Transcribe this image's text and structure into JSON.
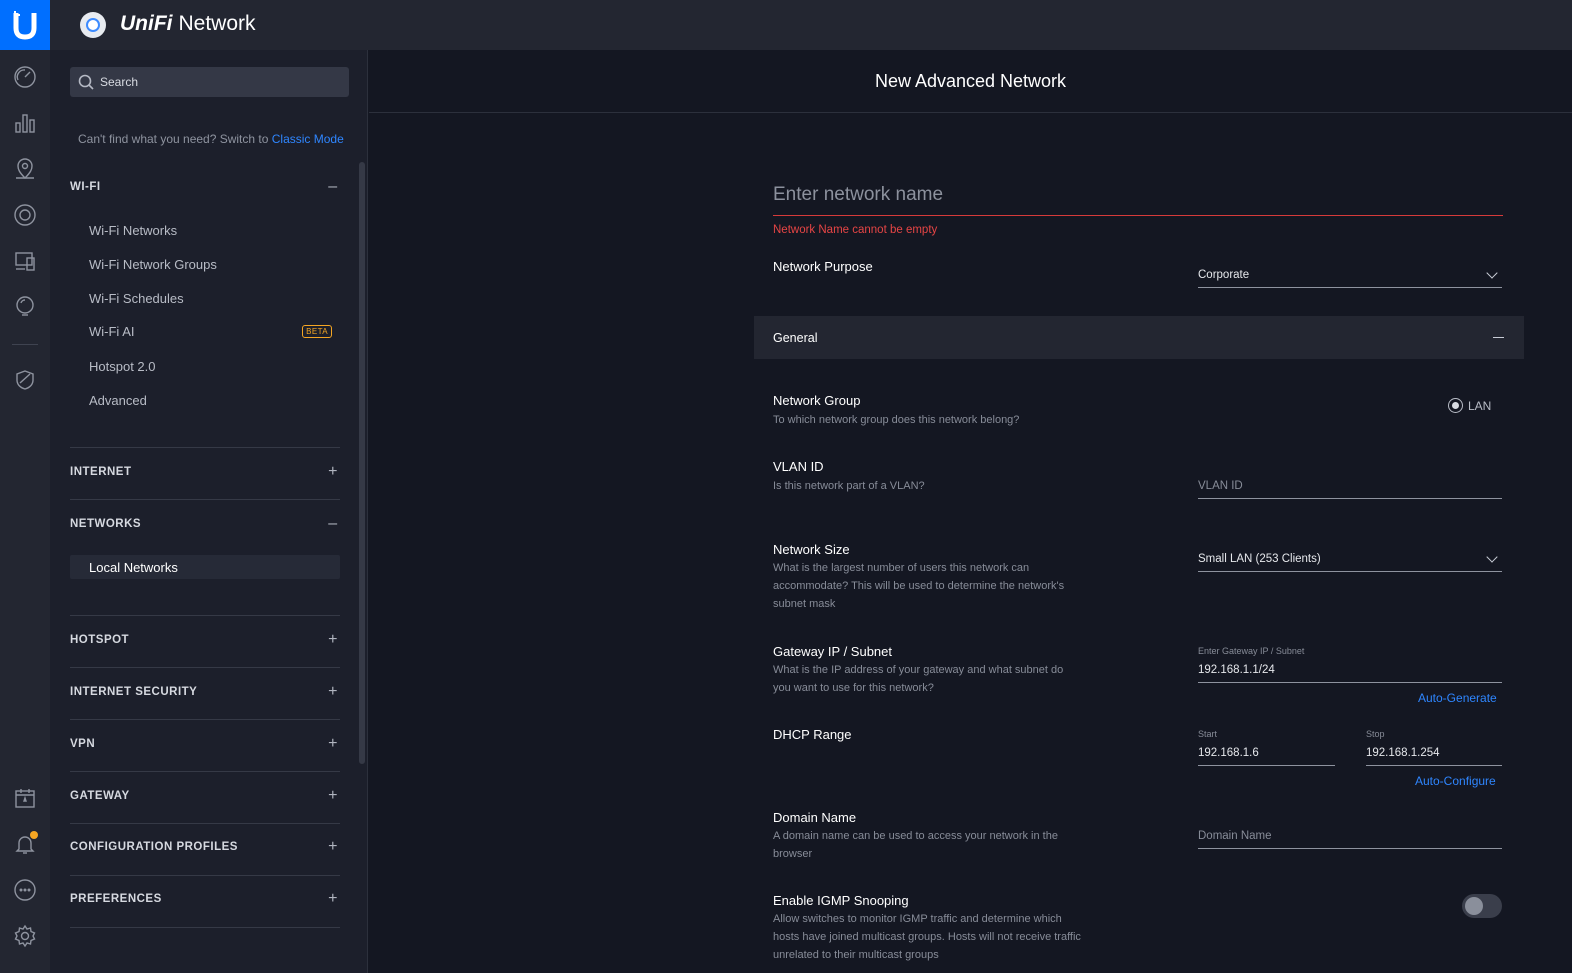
{
  "app": {
    "brand": "UniFi",
    "title": "Network"
  },
  "rail": {
    "items": [
      "dashboard-icon",
      "statistics-icon",
      "map-icon",
      "devices-icon",
      "clients-icon",
      "insights-icon",
      "security-shield-icon",
      "calendar-icon",
      "notifications-bell-icon",
      "chat-icon",
      "settings-gear-icon"
    ]
  },
  "sidebar": {
    "search": {
      "placeholder": "Search"
    },
    "classic_text": "Can't find what you need? Switch to",
    "classic_link": "Classic Mode",
    "sections": {
      "wifi": {
        "label": "WI-FI",
        "toggle": "–"
      },
      "internet": {
        "label": "INTERNET",
        "toggle": "+"
      },
      "networks": {
        "label": "NETWORKS",
        "toggle": "–"
      },
      "hotspot": {
        "label": "HOTSPOT",
        "toggle": "+"
      },
      "internet_security": {
        "label": "INTERNET SECURITY",
        "toggle": "+"
      },
      "vpn": {
        "label": "VPN",
        "toggle": "+"
      },
      "gateway": {
        "label": "GATEWAY",
        "toggle": "+"
      },
      "configuration_profiles": {
        "label": "CONFIGURATION PROFILES",
        "toggle": "+"
      },
      "preferences": {
        "label": "PREFERENCES",
        "toggle": "+"
      }
    },
    "wifi_items": [
      "Wi-Fi Networks",
      "Wi-Fi Network Groups",
      "Wi-Fi Schedules",
      "Wi-Fi AI",
      "Hotspot 2.0",
      "Advanced"
    ],
    "beta_badge": "BETA",
    "networks_items": [
      "Local Networks"
    ]
  },
  "main": {
    "title": "New Advanced Network",
    "name_input": {
      "placeholder": "Enter network name",
      "error": "Network Name cannot be empty"
    },
    "network_purpose": {
      "label": "Network Purpose",
      "value": "Corporate"
    },
    "general": {
      "label": "General"
    },
    "network_group": {
      "label": "Network Group",
      "desc": "To which network group does this network belong?",
      "option": "LAN"
    },
    "vlan_id": {
      "label": "VLAN ID",
      "desc": "Is this network part of a VLAN?",
      "placeholder": "VLAN ID"
    },
    "network_size": {
      "label": "Network Size",
      "desc": "What is the largest number of users this network can accommodate? This will be used to determine the network's subnet mask",
      "value": "Small LAN (253 Clients)"
    },
    "gateway": {
      "label": "Gateway IP / Subnet",
      "desc": "What is the IP address of your gateway and what subnet do you want to use for this network?",
      "field_label": "Enter Gateway IP / Subnet",
      "value": "192.168.1.1/24",
      "link": "Auto-Generate"
    },
    "dhcp": {
      "label": "DHCP Range",
      "start_label": "Start",
      "start_value": "192.168.1.6",
      "stop_label": "Stop",
      "stop_value": "192.168.1.254",
      "link": "Auto-Configure"
    },
    "domain": {
      "label": "Domain Name",
      "desc": "A domain name can be used to access your network in the browser",
      "placeholder": "Domain Name"
    },
    "igmp": {
      "label": "Enable IGMP Snooping",
      "desc": "Allow switches to monitor IGMP traffic and determine which hosts have joined multicast groups. Hosts will not receive traffic unrelated to their multicast groups",
      "enabled": false
    }
  },
  "colors": {
    "accent": "#006fff",
    "link": "#2f86ff",
    "error": "#e64545",
    "beta": "#f5a623"
  }
}
